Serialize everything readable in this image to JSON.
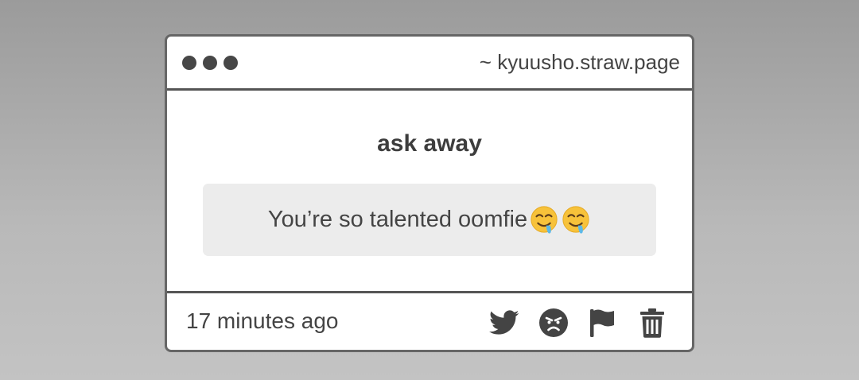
{
  "window": {
    "url": "~ kyuusho.straw.page"
  },
  "prompt": {
    "heading": "ask away"
  },
  "message": {
    "text": "You’re so talented oomfie",
    "emojis": [
      "drooling-face-emoji",
      "drooling-face-emoji"
    ]
  },
  "footer": {
    "timestamp": "17 minutes ago",
    "actions": [
      "twitter-icon",
      "angry-face-icon",
      "flag-icon",
      "trash-icon"
    ]
  },
  "colors": {
    "frame": "#666666",
    "text": "#444444",
    "message_bg": "#ececec",
    "emoji_face": "#f7c23a",
    "drool": "#5bb8e8"
  }
}
